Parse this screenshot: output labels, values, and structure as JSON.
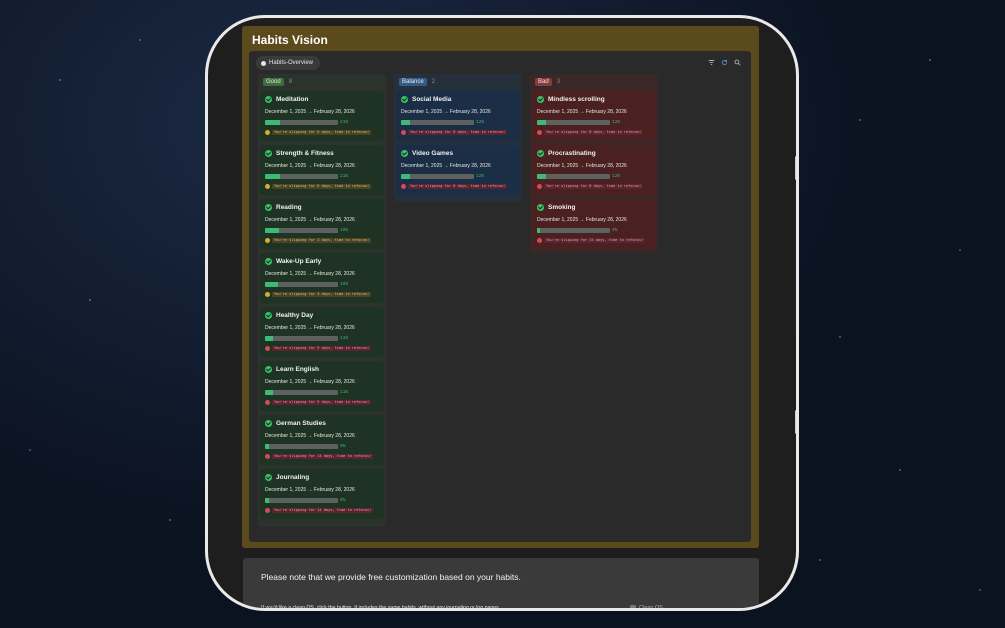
{
  "app": {
    "title": "Habits Vision"
  },
  "view": {
    "tab_label": "Habits-Overview"
  },
  "toolbar": {
    "icons": [
      "filter-icon",
      "refresh-icon",
      "search-icon"
    ]
  },
  "columns": {
    "good": {
      "label": "Good",
      "count": "8",
      "cards": [
        {
          "title": "Meditation",
          "dates": "December 1, 2025 → February 28, 2026",
          "progress": 0.21,
          "percent": "21%",
          "warning": "You're slipping for 6 days, time to refocus!",
          "level": "yellow"
        },
        {
          "title": "Strength & Fitness",
          "dates": "December 1, 2025 → February 28, 2026",
          "progress": 0.21,
          "percent": "21%",
          "warning": "You're slipping for 6 days, time to refocus!",
          "level": "yellow"
        },
        {
          "title": "Reading",
          "dates": "December 1, 2025 → February 28, 2026",
          "progress": 0.19,
          "percent": "19%",
          "warning": "You're slipping for 3 days, time to refocus!",
          "level": "yellow"
        },
        {
          "title": "Wake-Up Early",
          "dates": "December 1, 2025 → February 28, 2026",
          "progress": 0.18,
          "percent": "18%",
          "warning": "You're slipping for 3 days, time to refocus!",
          "level": "yellow"
        },
        {
          "title": "Healthy Day",
          "dates": "December 1, 2025 → February 28, 2026",
          "progress": 0.11,
          "percent": "11%",
          "warning": "You're slipping for 9 days, time to refocus!",
          "level": "red"
        },
        {
          "title": "Learn English",
          "dates": "December 1, 2025 → February 28, 2026",
          "progress": 0.11,
          "percent": "11%",
          "warning": "You're slipping for 9 days, time to refocus!",
          "level": "red"
        },
        {
          "title": "German Studies",
          "dates": "December 1, 2025 → February 28, 2026",
          "progress": 0.06,
          "percent": "6%",
          "warning": "You're slipping for 14 days, time to refocus!",
          "level": "red"
        },
        {
          "title": "Journaling",
          "dates": "December 1, 2025 → February 28, 2026",
          "progress": 0.06,
          "percent": "6%",
          "warning": "You're slipping for 14 days, time to refocus!",
          "level": "red"
        }
      ]
    },
    "balance": {
      "label": "Balance",
      "count": "2",
      "cards": [
        {
          "title": "Social Media",
          "dates": "December 1, 2025 → February 28, 2026",
          "progress": 0.12,
          "percent": "12%",
          "warning": "You're slipping for 8 days, time to refocus!",
          "level": "red"
        },
        {
          "title": "Video Games",
          "dates": "December 1, 2025 → February 28, 2026",
          "progress": 0.12,
          "percent": "12%",
          "warning": "You're slipping for 8 days, time to refocus!",
          "level": "red"
        }
      ]
    },
    "bad": {
      "label": "Bad",
      "count": "3",
      "cards": [
        {
          "title": "Mindless scrolling",
          "dates": "December 1, 2025 → February 28, 2026",
          "progress": 0.12,
          "percent": "12%",
          "warning": "You're slipping for 8 days, time to refocus!",
          "level": "red"
        },
        {
          "title": "Procrastinating",
          "dates": "December 1, 2025 → February 28, 2026",
          "progress": 0.12,
          "percent": "12%",
          "warning": "You're slipping for 8 days, time to refocus!",
          "level": "red"
        },
        {
          "title": "Smoking",
          "dates": "December 1, 2025 → February 28, 2026",
          "progress": 0.04,
          "percent": "4%",
          "warning": "You're slipping for 15 days, time to refocus!",
          "level": "red"
        }
      ]
    }
  },
  "note": {
    "headline": "Please note that we provide free customization based on your habits.",
    "body": "If you'd like a clean OS, click the button. It includes the same habits, without any journaling or log pages.",
    "button_label": "Clean OS"
  },
  "colors": {
    "accent_frame": "#5b4a1b",
    "progress": "#3dbb74",
    "good": "#3b6e3b",
    "balance": "#335b8a",
    "bad": "#8a3a3a"
  }
}
